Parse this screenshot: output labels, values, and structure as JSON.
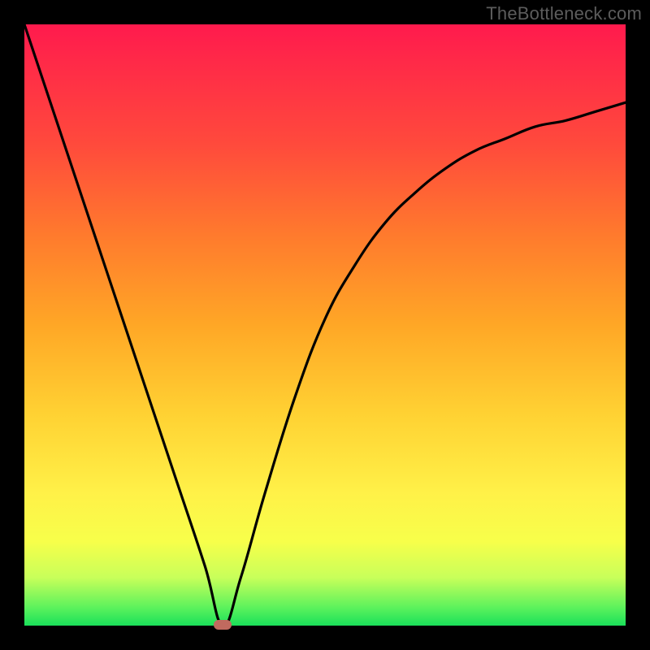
{
  "watermark": "TheBottleneck.com",
  "chart_data": {
    "type": "line",
    "title": "",
    "xlabel": "",
    "ylabel": "",
    "xlim": [
      0,
      100
    ],
    "ylim": [
      0,
      100
    ],
    "grid": false,
    "legend": false,
    "series": [
      {
        "name": "curve",
        "x": [
          0,
          5,
          10,
          15,
          20,
          25,
          30,
          33,
          36,
          40,
          45,
          50,
          55,
          60,
          65,
          70,
          75,
          80,
          85,
          90,
          95,
          100
        ],
        "y": [
          100,
          85,
          70,
          55,
          40,
          25,
          10,
          0,
          8,
          22,
          38,
          51,
          60,
          67,
          72,
          76,
          79,
          81,
          83,
          84,
          85.5,
          87
        ],
        "color": "#000000"
      }
    ],
    "annotations": [
      {
        "name": "vertex-marker",
        "x": 33,
        "y": 0,
        "color": "#c16a5f"
      }
    ],
    "background_gradient": {
      "direction": "vertical",
      "stops": [
        {
          "pos": 0,
          "color": "#ff1a4d"
        },
        {
          "pos": 50,
          "color": "#ffa726"
        },
        {
          "pos": 80,
          "color": "#fff148"
        },
        {
          "pos": 100,
          "color": "#1ae05a"
        }
      ]
    }
  }
}
